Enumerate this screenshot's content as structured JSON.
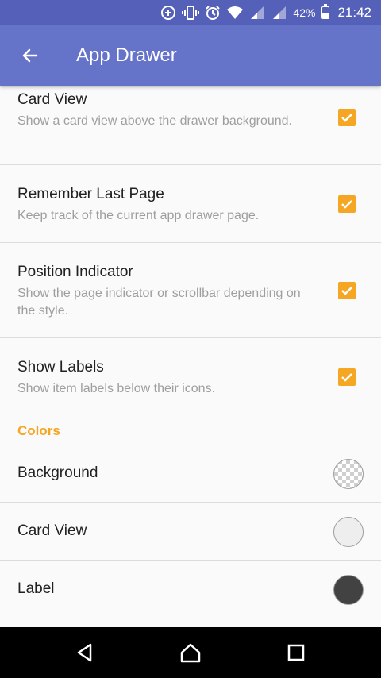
{
  "status_bar": {
    "battery_text": "42%",
    "battery_level": 0.42,
    "time": "21:42",
    "icons": [
      "data-saver-icon",
      "vibrate-icon",
      "alarm-icon",
      "wifi-icon",
      "signal-icon",
      "signal-icon",
      "battery-icon"
    ]
  },
  "app_bar": {
    "title": "App Drawer",
    "back_icon": "arrow-back-icon"
  },
  "prefs": [
    {
      "title": "Card View",
      "summary": "Show a card view above the drawer background.",
      "checked": true
    },
    {
      "title": "Remember Last Page",
      "summary": "Keep track of the current app drawer page.",
      "checked": true
    },
    {
      "title": "Position Indicator",
      "summary": "Show the page indicator or scrollbar depending on the style.",
      "checked": true
    },
    {
      "title": "Show Labels",
      "summary": "Show item labels below their icons.",
      "checked": true
    }
  ],
  "colors_category": {
    "header": "Colors",
    "items": [
      {
        "title": "Background",
        "swatch": "transparent"
      },
      {
        "title": "Card View",
        "swatch": "#eeeeee"
      },
      {
        "title": "Label",
        "swatch": "#424242"
      }
    ]
  },
  "nav_bar": {
    "icons": [
      "back-triangle-icon",
      "home-icon",
      "recents-icon"
    ]
  },
  "colors": {
    "status_bar": "#5561b8",
    "app_bar": "#6573c9",
    "accent": "#f5a623"
  }
}
